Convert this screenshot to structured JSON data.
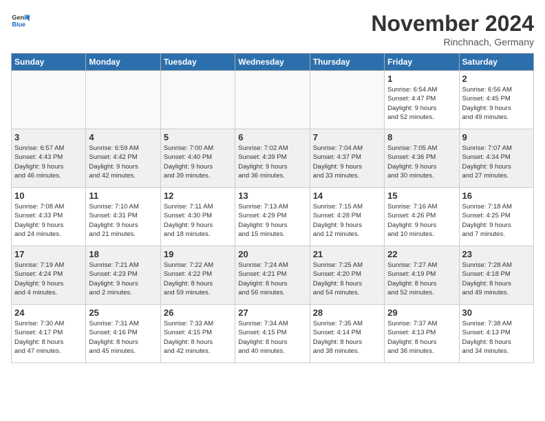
{
  "logo": {
    "line1": "General",
    "line2": "Blue"
  },
  "title": "November 2024",
  "location": "Rinchnach, Germany",
  "days": [
    "Sunday",
    "Monday",
    "Tuesday",
    "Wednesday",
    "Thursday",
    "Friday",
    "Saturday"
  ],
  "weeks": [
    [
      {
        "num": "",
        "info": ""
      },
      {
        "num": "",
        "info": ""
      },
      {
        "num": "",
        "info": ""
      },
      {
        "num": "",
        "info": ""
      },
      {
        "num": "",
        "info": ""
      },
      {
        "num": "1",
        "info": "Sunrise: 6:54 AM\nSunset: 4:47 PM\nDaylight: 9 hours\nand 52 minutes."
      },
      {
        "num": "2",
        "info": "Sunrise: 6:56 AM\nSunset: 4:45 PM\nDaylight: 9 hours\nand 49 minutes."
      }
    ],
    [
      {
        "num": "3",
        "info": "Sunrise: 6:57 AM\nSunset: 4:43 PM\nDaylight: 9 hours\nand 46 minutes."
      },
      {
        "num": "4",
        "info": "Sunrise: 6:59 AM\nSunset: 4:42 PM\nDaylight: 9 hours\nand 42 minutes."
      },
      {
        "num": "5",
        "info": "Sunrise: 7:00 AM\nSunset: 4:40 PM\nDaylight: 9 hours\nand 39 minutes."
      },
      {
        "num": "6",
        "info": "Sunrise: 7:02 AM\nSunset: 4:39 PM\nDaylight: 9 hours\nand 36 minutes."
      },
      {
        "num": "7",
        "info": "Sunrise: 7:04 AM\nSunset: 4:37 PM\nDaylight: 9 hours\nand 33 minutes."
      },
      {
        "num": "8",
        "info": "Sunrise: 7:05 AM\nSunset: 4:36 PM\nDaylight: 9 hours\nand 30 minutes."
      },
      {
        "num": "9",
        "info": "Sunrise: 7:07 AM\nSunset: 4:34 PM\nDaylight: 9 hours\nand 27 minutes."
      }
    ],
    [
      {
        "num": "10",
        "info": "Sunrise: 7:08 AM\nSunset: 4:33 PM\nDaylight: 9 hours\nand 24 minutes."
      },
      {
        "num": "11",
        "info": "Sunrise: 7:10 AM\nSunset: 4:31 PM\nDaylight: 9 hours\nand 21 minutes."
      },
      {
        "num": "12",
        "info": "Sunrise: 7:11 AM\nSunset: 4:30 PM\nDaylight: 9 hours\nand 18 minutes."
      },
      {
        "num": "13",
        "info": "Sunrise: 7:13 AM\nSunset: 4:29 PM\nDaylight: 9 hours\nand 15 minutes."
      },
      {
        "num": "14",
        "info": "Sunrise: 7:15 AM\nSunset: 4:28 PM\nDaylight: 9 hours\nand 12 minutes."
      },
      {
        "num": "15",
        "info": "Sunrise: 7:16 AM\nSunset: 4:26 PM\nDaylight: 9 hours\nand 10 minutes."
      },
      {
        "num": "16",
        "info": "Sunrise: 7:18 AM\nSunset: 4:25 PM\nDaylight: 9 hours\nand 7 minutes."
      }
    ],
    [
      {
        "num": "17",
        "info": "Sunrise: 7:19 AM\nSunset: 4:24 PM\nDaylight: 9 hours\nand 4 minutes."
      },
      {
        "num": "18",
        "info": "Sunrise: 7:21 AM\nSunset: 4:23 PM\nDaylight: 9 hours\nand 2 minutes."
      },
      {
        "num": "19",
        "info": "Sunrise: 7:22 AM\nSunset: 4:22 PM\nDaylight: 8 hours\nand 59 minutes."
      },
      {
        "num": "20",
        "info": "Sunrise: 7:24 AM\nSunset: 4:21 PM\nDaylight: 8 hours\nand 56 minutes."
      },
      {
        "num": "21",
        "info": "Sunrise: 7:25 AM\nSunset: 4:20 PM\nDaylight: 8 hours\nand 54 minutes."
      },
      {
        "num": "22",
        "info": "Sunrise: 7:27 AM\nSunset: 4:19 PM\nDaylight: 8 hours\nand 52 minutes."
      },
      {
        "num": "23",
        "info": "Sunrise: 7:28 AM\nSunset: 4:18 PM\nDaylight: 8 hours\nand 49 minutes."
      }
    ],
    [
      {
        "num": "24",
        "info": "Sunrise: 7:30 AM\nSunset: 4:17 PM\nDaylight: 8 hours\nand 47 minutes."
      },
      {
        "num": "25",
        "info": "Sunrise: 7:31 AM\nSunset: 4:16 PM\nDaylight: 8 hours\nand 45 minutes."
      },
      {
        "num": "26",
        "info": "Sunrise: 7:33 AM\nSunset: 4:15 PM\nDaylight: 8 hours\nand 42 minutes."
      },
      {
        "num": "27",
        "info": "Sunrise: 7:34 AM\nSunset: 4:15 PM\nDaylight: 8 hours\nand 40 minutes."
      },
      {
        "num": "28",
        "info": "Sunrise: 7:35 AM\nSunset: 4:14 PM\nDaylight: 8 hours\nand 38 minutes."
      },
      {
        "num": "29",
        "info": "Sunrise: 7:37 AM\nSunset: 4:13 PM\nDaylight: 8 hours\nand 36 minutes."
      },
      {
        "num": "30",
        "info": "Sunrise: 7:38 AM\nSunset: 4:13 PM\nDaylight: 8 hours\nand 34 minutes."
      }
    ]
  ]
}
